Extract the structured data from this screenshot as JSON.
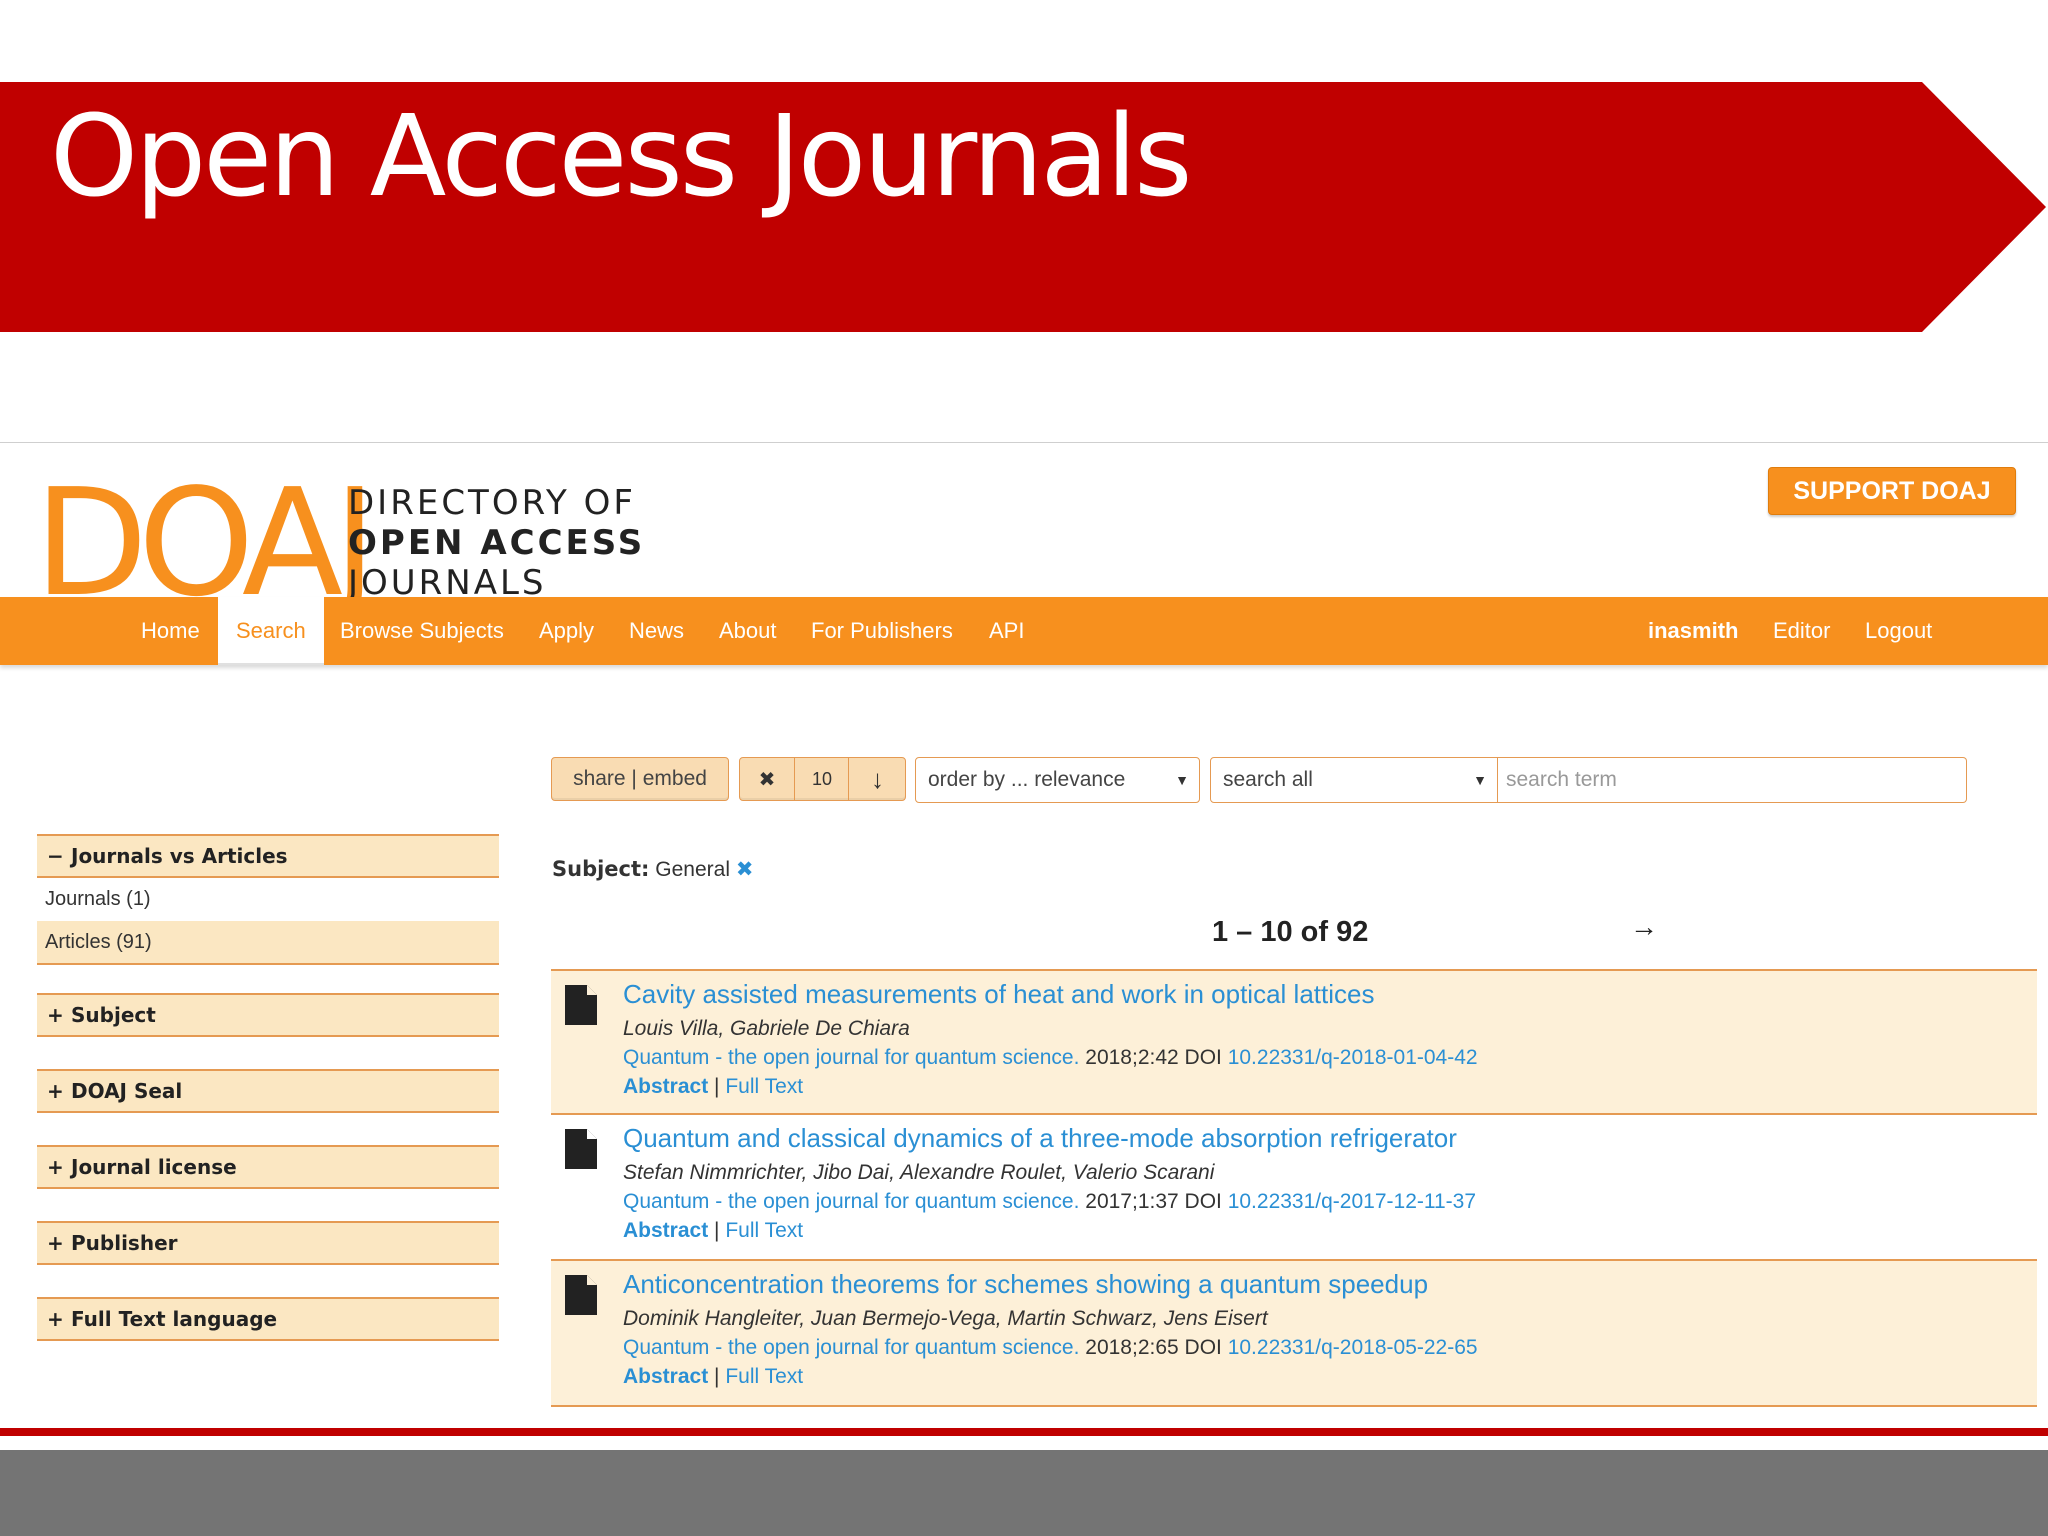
{
  "slide": {
    "title": "Open Access Journals",
    "banner_color": "#c00000"
  },
  "site": {
    "logo_mark": "DOAJ",
    "logo_lines": [
      "DIRECTORY OF",
      "OPEN ACCESS",
      "JOURNALS"
    ],
    "support_label": "SUPPORT DOAJ",
    "accent": "#f7901e"
  },
  "nav": {
    "items": [
      "Home",
      "Search",
      "Browse Subjects",
      "Apply",
      "News",
      "About",
      "For Publishers",
      "API"
    ],
    "active": "Search",
    "user": "inasmith",
    "editor": "Editor",
    "logout": "Logout"
  },
  "toolbar": {
    "share_label": "share | embed",
    "clear_icon": "✖",
    "page_size": "10",
    "sort_dir_icon": "↓",
    "order_value": "order by ... relevance",
    "field_value": "search all",
    "search_placeholder": "search term"
  },
  "facets": {
    "journals_vs_articles": {
      "label": "Journals vs Articles",
      "sign": "−",
      "rows": [
        "Journals (1)",
        "Articles (91)"
      ]
    },
    "collapsed": [
      {
        "sign": "+",
        "label": "Subject"
      },
      {
        "sign": "+",
        "label": "DOAJ Seal"
      },
      {
        "sign": "+",
        "label": "Journal license"
      },
      {
        "sign": "+",
        "label": "Publisher"
      },
      {
        "sign": "+",
        "label": "Full Text language"
      }
    ]
  },
  "filter": {
    "key": "Subject:",
    "value": "General",
    "remove_icon": "✖"
  },
  "pager": {
    "range": "1 – 10 of 92",
    "next_icon": "→"
  },
  "results": [
    {
      "title": "Cavity assisted measurements of heat and work in optical lattices",
      "authors": "Louis Villa, Gabriele De Chiara",
      "journal": "Quantum - the open journal for quantum science.",
      "cite": " 2018;2:42 DOI ",
      "doi": "10.22331/q-2018-01-04-42",
      "abstract": "Abstract",
      "sep": " | ",
      "fulltext": "Full Text"
    },
    {
      "title": "Quantum and classical dynamics of a three-mode absorption refrigerator",
      "authors": "Stefan Nimmrichter, Jibo Dai, Alexandre Roulet, Valerio Scarani",
      "journal": "Quantum - the open journal for quantum science.",
      "cite": " 2017;1:37 DOI ",
      "doi": "10.22331/q-2017-12-11-37",
      "abstract": "Abstract",
      "sep": " | ",
      "fulltext": "Full Text"
    },
    {
      "title": "Anticoncentration theorems for schemes showing a quantum speedup",
      "authors": "Dominik Hangleiter, Juan Bermejo-Vega, Martin Schwarz, Jens Eisert",
      "journal": "Quantum - the open journal for quantum science.",
      "cite": " 2018;2:65 DOI ",
      "doi": "10.22331/q-2018-05-22-65",
      "abstract": "Abstract",
      "sep": " | ",
      "fulltext": "Full Text"
    }
  ]
}
